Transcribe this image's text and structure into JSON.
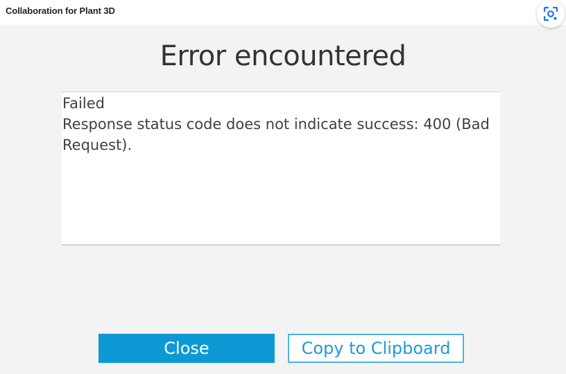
{
  "window": {
    "title": "Collaboration for Plant 3D"
  },
  "dialog": {
    "heading": "Error encountered",
    "message_lines": [
      "Failed",
      "Response status code does not indicate success: 400 (Bad",
      "Request)."
    ],
    "close_label": "Close",
    "copy_label": "Copy to Clipboard"
  },
  "icons": {
    "lens": "visual-search-icon"
  },
  "colors": {
    "primary_button": "#0d99d4",
    "secondary_button_border": "#4ab4df",
    "secondary_button_text": "#1e9ad6",
    "background": "#f3f3f3"
  }
}
